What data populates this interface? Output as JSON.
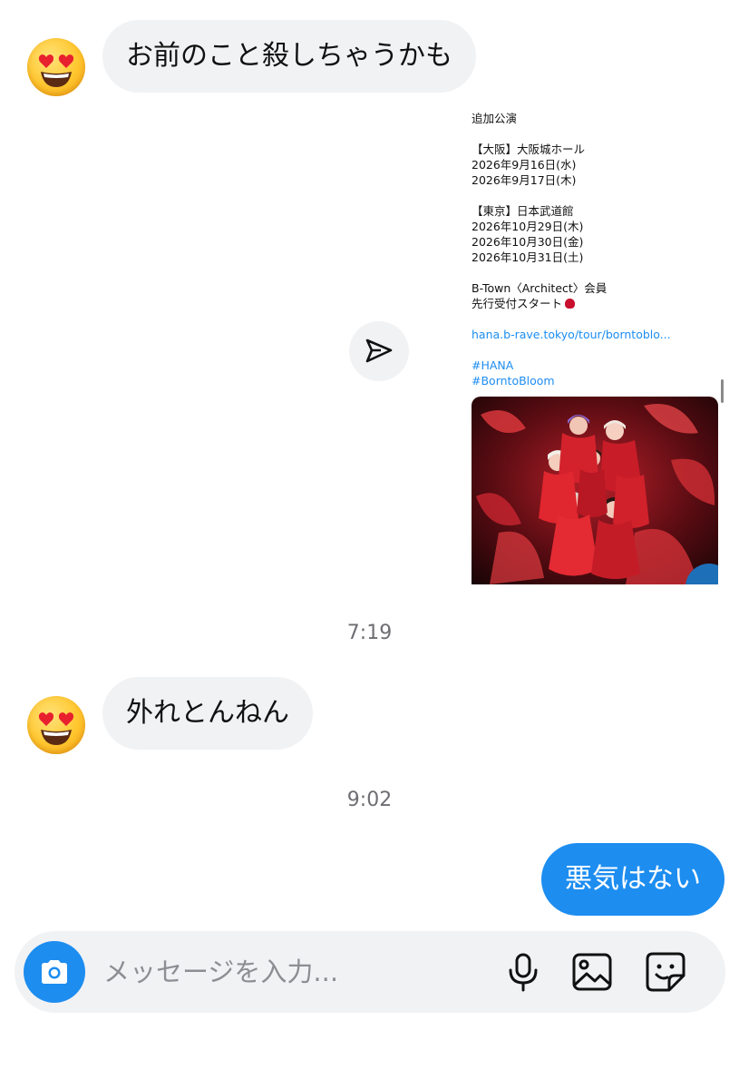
{
  "messages": [
    {
      "id": 1,
      "direction": "incoming",
      "text": "お前のこと殺しちゃうかも"
    },
    {
      "id": 2,
      "direction": "incoming",
      "type": "shared-post"
    },
    {
      "id": 3,
      "direction": "incoming",
      "text": "外れとんねん"
    },
    {
      "id": 4,
      "direction": "outgoing",
      "text": "悪気はない"
    }
  ],
  "timestamps": [
    "7:19",
    "9:02"
  ],
  "shared_post": {
    "lines": [
      "追加公演",
      "",
      "【大阪】大阪城ホール",
      "2026年9月16日(水)",
      "2026年9月17日(木)",
      "",
      "【東京】日本武道館",
      "2026年10月29日(木)",
      "2026年10月30日(金)",
      "2026年10月31日(土)",
      "",
      "B-Town〈Architect〉会員",
      "先行受付スタート",
      "",
      "hana.b-rave.tokyo/tour/borntoblo...",
      "",
      "#HANA",
      "#BorntoBloom"
    ]
  },
  "composer": {
    "placeholder": "メッセージを入力..."
  },
  "icons": {
    "avatar": "heart-eyes-emoji",
    "share": "send-icon",
    "camera": "camera-icon",
    "mic": "microphone-icon",
    "gallery": "image-icon",
    "sticker": "sticker-icon"
  },
  "colors": {
    "accent": "#1d8df0",
    "incoming_bubble": "#f1f2f4",
    "timestamp": "#6e6e73"
  }
}
